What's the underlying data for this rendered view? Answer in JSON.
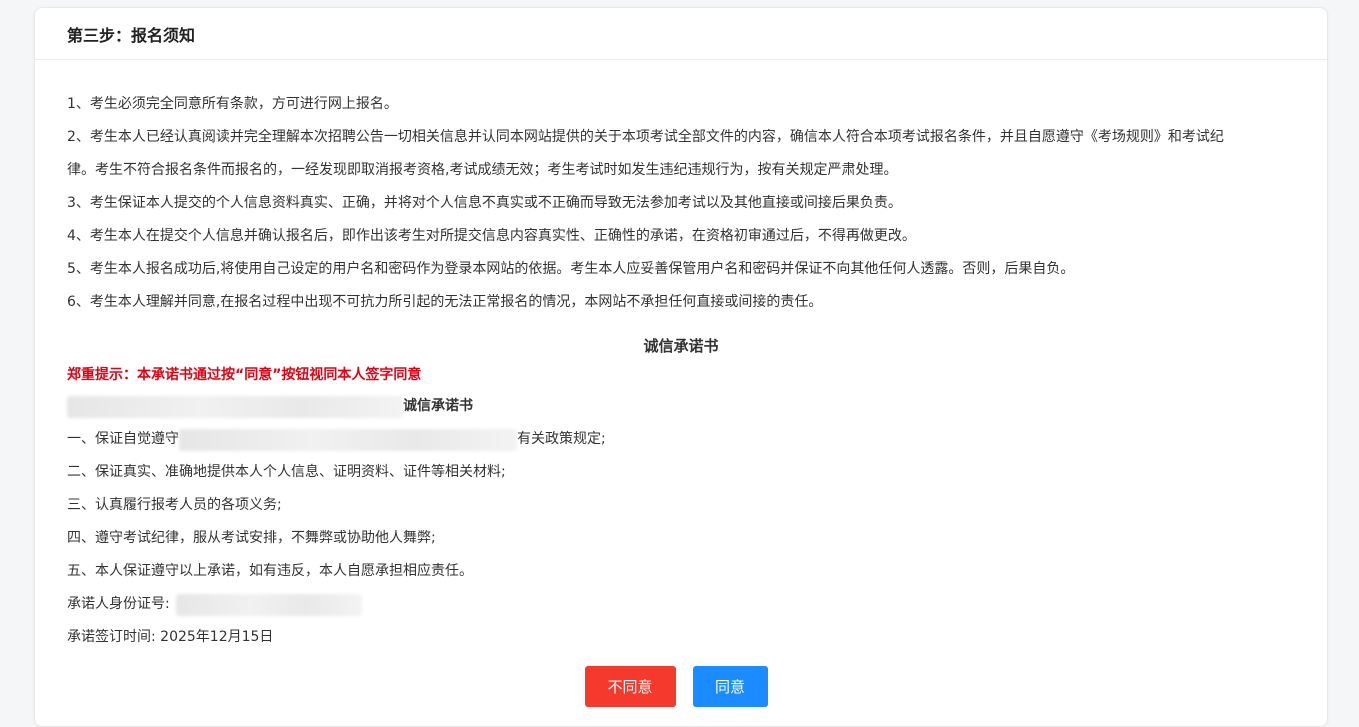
{
  "header": {
    "title": "第三步：报名须知"
  },
  "notices": [
    "1、考生必须完全同意所有条款，方可进行网上报名。",
    "2、考生本人已经认真阅读并完全理解本次招聘公告一切相关信息并认同本网站提供的关于本项考试全部文件的内容，确信本人符合本项考试报名条件，并且自愿遵守《考场规则》和考试纪",
    "律。考生不符合报名条件而报名的，一经发现即取消报考资格,考试成绩无效；考生考试时如发生违纪违规行为，按有关规定严肃处理。",
    "3、考生保证本人提交的个人信息资料真实、正确，并将对个人信息不真实或不正确而导致无法参加考试以及其他直接或间接后果负责。",
    "4、考生本人在提交个人信息并确认报名后，即作出该考生对所提交信息内容真实性、正确性的承诺，在资格初审通过后，不得再做更改。",
    "5、考生本人报名成功后,将使用自己设定的用户名和密码作为登录本网站的依据。考生本人应妥善保管用户名和密码并保证不向其他任何人透露。否则，后果自负。",
    "6、考生本人理解并同意,在报名过程中出现不可抗力所引起的无法正常报名的情况，本网站不承担任何直接或间接的责任。"
  ],
  "pledge": {
    "heading": "诚信承诺书",
    "warning": "郑重提示：本承诺书通过按“同意”按钮视同本人签字同意",
    "subtitle_suffix": "诚信承诺书",
    "item1_prefix": "一、保证自觉遵守",
    "item1_suffix": "有关政策规定;",
    "items": [
      "二、保证真实、准确地提供本人个人信息、证明资料、证件等相关材料;",
      "三、认真履行报考人员的各项义务;",
      "四、遵守考试纪律，服从考试安排，不舞弊或协助他人舞弊;",
      "五、本人保证遵守以上承诺，如有违反，本人自愿承担相应责任。"
    ],
    "id_label": "承诺人身份证号:",
    "date_label": "承诺签订时间: 2025年12月15日"
  },
  "buttons": {
    "disagree": "不同意",
    "agree": "同意"
  },
  "colors": {
    "warning": "#e60012",
    "disagree_bg": "#f5392c",
    "agree_bg": "#1a8cff"
  }
}
